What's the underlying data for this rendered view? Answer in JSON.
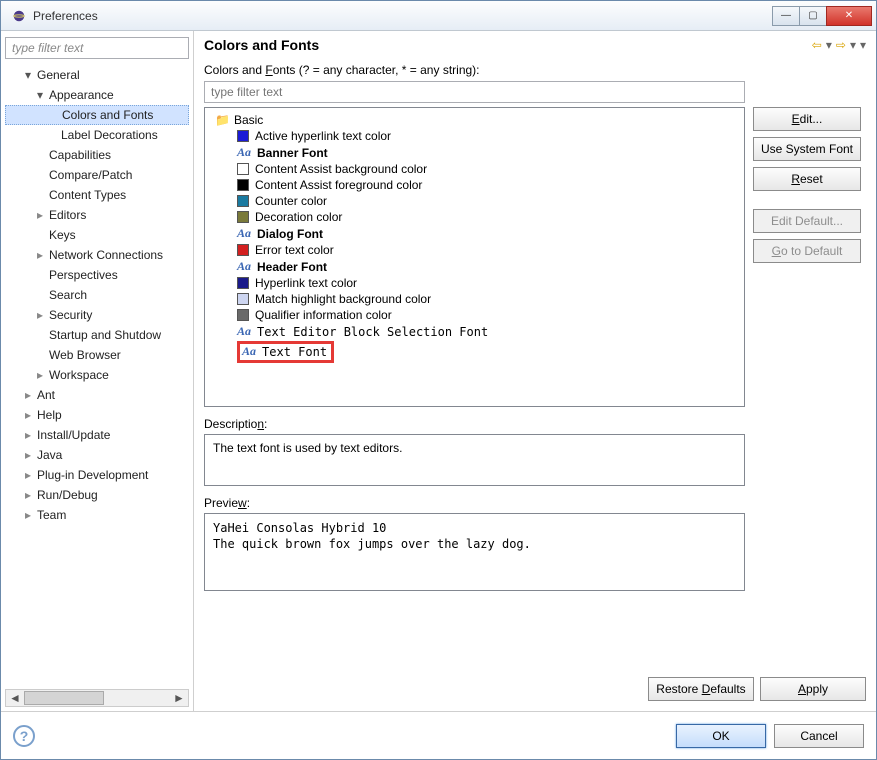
{
  "window": {
    "title": "Preferences"
  },
  "sidebar": {
    "filter_placeholder": "type filter text",
    "nodes": {
      "general": "General",
      "appearance": "Appearance",
      "colors_fonts": "Colors and Fonts",
      "label_decorations": "Label Decorations",
      "capabilities": "Capabilities",
      "compare_patch": "Compare/Patch",
      "content_types": "Content Types",
      "editors": "Editors",
      "keys": "Keys",
      "network": "Network Connections",
      "perspectives": "Perspectives",
      "search": "Search",
      "security": "Security",
      "startup": "Startup and Shutdow",
      "web_browser": "Web Browser",
      "workspace": "Workspace",
      "ant": "Ant",
      "help": "Help",
      "install": "Install/Update",
      "java": "Java",
      "plugin_dev": "Plug-in Development",
      "run_debug": "Run/Debug",
      "team": "Team"
    }
  },
  "main": {
    "heading": "Colors and Fonts",
    "hint": "Colors and Fonts (? = any character, * = any string):",
    "filter_placeholder": "type filter text",
    "group": "Basic",
    "items": [
      {
        "label": "Active hyperlink text color",
        "type": "color",
        "color": "#1b1bd5"
      },
      {
        "label": "Banner Font",
        "type": "font",
        "bold": true
      },
      {
        "label": "Content Assist background color",
        "type": "color",
        "color": "#ffffff"
      },
      {
        "label": "Content Assist foreground color",
        "type": "color",
        "color": "#000000"
      },
      {
        "label": "Counter color",
        "type": "color",
        "color": "#1a7aa0"
      },
      {
        "label": "Decoration color",
        "type": "color",
        "color": "#7a7a3a"
      },
      {
        "label": "Dialog Font",
        "type": "font",
        "bold": true
      },
      {
        "label": "Error text color",
        "type": "color",
        "color": "#d32020"
      },
      {
        "label": "Header Font",
        "type": "font",
        "bold": true
      },
      {
        "label": "Hyperlink text color",
        "type": "color",
        "color": "#1a1a8a"
      },
      {
        "label": "Match highlight background color",
        "type": "color",
        "color": "#cdd5f0"
      },
      {
        "label": "Qualifier information color",
        "type": "color",
        "color": "#6a6a6a"
      },
      {
        "label": "Text Editor Block Selection Font",
        "type": "font",
        "bold": false
      },
      {
        "label": "Text Font",
        "type": "font",
        "bold": false,
        "selected": true
      }
    ],
    "buttons": {
      "edit": "Edit...",
      "use_system": "Use System Font",
      "reset": "Reset",
      "edit_default": "Edit Default...",
      "go_default": "Go to Default"
    },
    "desc_label": "Description:",
    "desc_text": "The text font is used by text editors.",
    "preview_label": "Preview:",
    "preview_text": "YaHei Consolas Hybrid 10\nThe quick brown fox jumps over the lazy dog.",
    "restore_defaults": "Restore Defaults",
    "apply": "Apply"
  },
  "bottom": {
    "ok": "OK",
    "cancel": "Cancel"
  }
}
